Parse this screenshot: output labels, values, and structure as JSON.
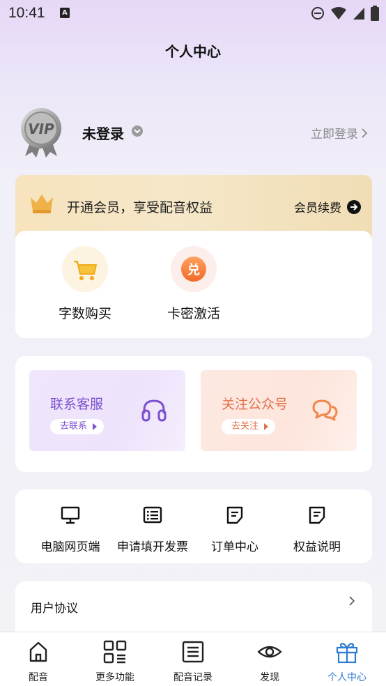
{
  "status": {
    "time": "10:41",
    "notif_letter": "A"
  },
  "page": {
    "title": "个人中心"
  },
  "profile": {
    "vip_text": "VIP",
    "name": "未登录",
    "login_label": "立即登录"
  },
  "vip_banner": {
    "text": "开通会员，享受配音权益",
    "renew_label": "会员续费"
  },
  "shop": [
    {
      "label": "字数购买",
      "icon": "cart-icon"
    },
    {
      "label": "卡密激活",
      "icon": "redeem-icon",
      "glyph": "兑"
    }
  ],
  "services": [
    {
      "title": "联系客服",
      "button": "去联系",
      "icon": "headset-icon",
      "accent": "#7b4fd0"
    },
    {
      "title": "关注公众号",
      "button": "去关注",
      "icon": "chat-bubbles-icon",
      "accent": "#e2714a"
    }
  ],
  "tools": [
    {
      "label": "电脑网页端",
      "icon": "monitor-icon"
    },
    {
      "label": "申请填开发票",
      "icon": "list-icon"
    },
    {
      "label": "订单中心",
      "icon": "order-icon"
    },
    {
      "label": "权益说明",
      "icon": "document-icon"
    }
  ],
  "agreement": {
    "label": "用户协议"
  },
  "nav": [
    {
      "label": "配音",
      "icon": "home-icon"
    },
    {
      "label": "更多功能",
      "icon": "grid-icon"
    },
    {
      "label": "配音记录",
      "icon": "record-list-icon"
    },
    {
      "label": "发现",
      "icon": "eye-icon"
    },
    {
      "label": "个人中心",
      "icon": "gift-icon",
      "active": true
    }
  ],
  "colors": {
    "active_nav": "#2f7bd0",
    "banner_gold": "#f2b94a",
    "text_gray": "#8a8a8a"
  }
}
